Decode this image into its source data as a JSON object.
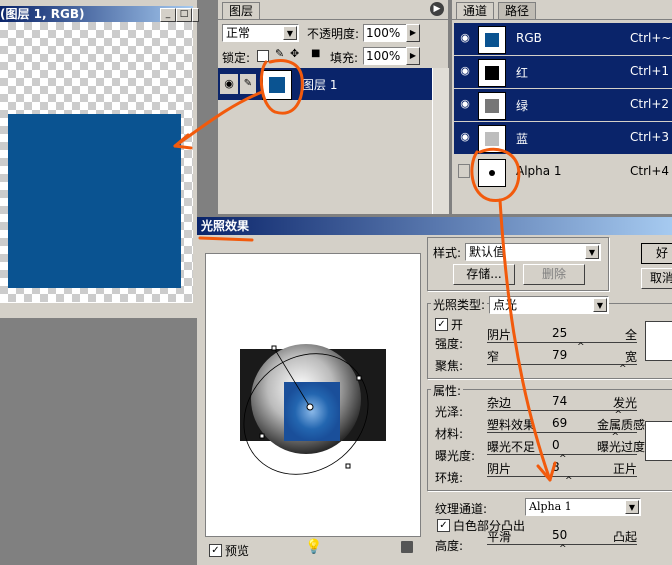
{
  "document_window": {
    "title": "(图层 1, RGB)",
    "fill_color": "#0a5391"
  },
  "layers_panel": {
    "tab": "图层",
    "blend_mode": "正常",
    "opacity_label": "不透明度:",
    "opacity_value": "100%",
    "lock_label": "锁定:",
    "fill_label": "填充:",
    "fill_value": "100%",
    "layer_name": "图层 1"
  },
  "channels_panel": {
    "tabs": [
      "通道",
      "路径"
    ],
    "channels": [
      {
        "name": "RGB",
        "shortcut": "Ctrl+~",
        "thumb_color": "#0a5391"
      },
      {
        "name": "红",
        "shortcut": "Ctrl+1",
        "thumb_color": "#000000"
      },
      {
        "name": "绿",
        "shortcut": "Ctrl+2",
        "thumb_color": "#777777"
      },
      {
        "name": "蓝",
        "shortcut": "Ctrl+3",
        "thumb_color": "#bdbdbd"
      },
      {
        "name": "Alpha 1",
        "shortcut": "Ctrl+4",
        "thumb_color": "#ffffff"
      }
    ]
  },
  "lighting_dialog": {
    "title": "光照效果",
    "style_label": "样式:",
    "style_value": "默认值",
    "save_button": "存储...",
    "delete_button": "删除",
    "ok_button": "好",
    "cancel_button": "取消",
    "light_type_label": "光照类型:",
    "light_type_value": "点光",
    "on_label": "开",
    "intensity": {
      "label": "强度:",
      "left": "阴片",
      "value": "25",
      "right": "全",
      "level": 0.62
    },
    "focus": {
      "label": "聚焦:",
      "left": "窄",
      "value": "79",
      "right": "宽",
      "level": 0.9
    },
    "properties_label": "属性:",
    "gloss": {
      "label": "光泽:",
      "left": "杂边",
      "value": "74",
      "right": "发光",
      "level": 0.87
    },
    "material": {
      "label": "材料:",
      "left": "塑料效果",
      "value": "69",
      "right": "金属质感",
      "level": 0.85
    },
    "exposure": {
      "label": "曝光度:",
      "left": "曝光不足",
      "value": "0",
      "right": "曝光过度",
      "level": 0.5
    },
    "ambience": {
      "label": "环境:",
      "left": "阴片",
      "value": "8",
      "right": "正片",
      "level": 0.54
    },
    "texture_channel_label": "纹理通道:",
    "texture_channel_value": "Alpha 1",
    "white_high_label": "白色部分凸出",
    "height": {
      "label": "高度:",
      "left": "平滑",
      "value": "50",
      "right": "凸起",
      "level": 0.5
    },
    "preview_label": "预览"
  }
}
